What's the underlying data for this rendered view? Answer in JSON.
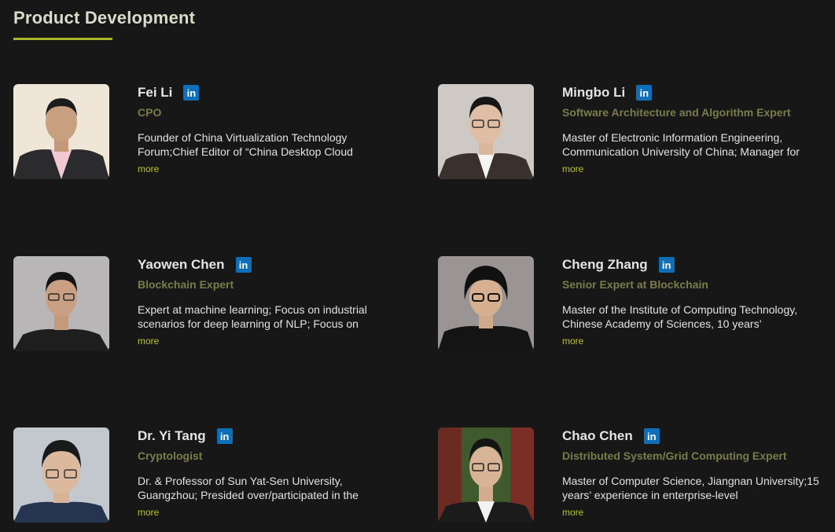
{
  "section": {
    "title": "Product Development"
  },
  "colors": {
    "background": "#171717",
    "accent": "#a8b42a",
    "role_text": "#7a7d4a",
    "more_link": "#b9c22d",
    "linkedin": "#0e6eb8"
  },
  "linkedin_label": "in",
  "members": [
    {
      "name": "Fei Li",
      "role": "CPO",
      "description": "Founder of China Virtualization Technology Forum;Chief Editor of “China Desktop Cloud",
      "more": "more"
    },
    {
      "name": "Mingbo Li",
      "role": "Software Architecture and Algorithm Expert",
      "description": "Master of Electronic Information Engineering, Communication University of China; Manager for",
      "more": "more"
    },
    {
      "name": "Yaowen Chen",
      "role": "Blockchain Expert",
      "description": "Expert at machine learning; Focus on industrial scenarios for deep learning of NLP; Focus on",
      "more": "more"
    },
    {
      "name": "Cheng Zhang",
      "role": "Senior Expert at Blockchain",
      "description": "Master of the Institute of Computing Technology, Chinese Academy of Sciences, 10 years’",
      "more": "more"
    },
    {
      "name": "Dr. Yi Tang",
      "role": "Cryptologist",
      "description": "Dr. & Professor of Sun Yat-Sen University, Guangzhou; Presided over/participated in the",
      "more": "more"
    },
    {
      "name": "Chao Chen",
      "role": "Distributed System/Grid Computing Expert",
      "description": "Master of Computer Science, Jiangnan University;15 years’ experience in enterprise-level",
      "more": "more"
    }
  ]
}
